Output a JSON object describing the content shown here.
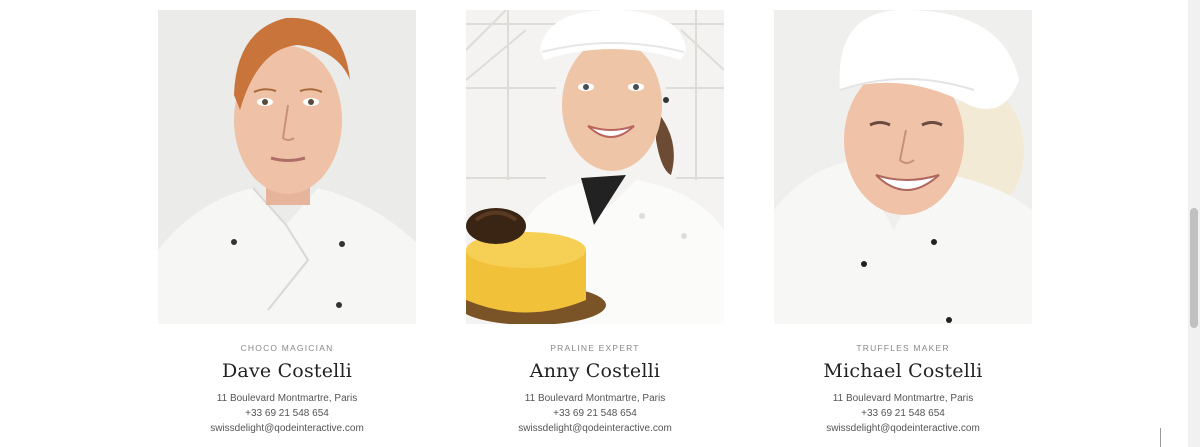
{
  "team": [
    {
      "role": "CHOCO MAGICIAN",
      "name": "Dave Costelli",
      "address": "11 Boulevard Montmartre, Paris",
      "phone": "+33 69 21 548 654",
      "email": "swissdelight@qodeinteractive.com"
    },
    {
      "role": "PRALINE EXPERT",
      "name": "Anny Costelli",
      "address": "11 Boulevard Montmartre, Paris",
      "phone": "+33 69 21 548 654",
      "email": "swissdelight@qodeinteractive.com"
    },
    {
      "role": "TRUFFLES MAKER",
      "name": "Michael Costelli",
      "address": "11 Boulevard Montmartre, Paris",
      "phone": "+33 69 21 548 654",
      "email": "swissdelight@qodeinteractive.com"
    }
  ],
  "colors": {
    "background": "#ffffff",
    "name_text": "#222222",
    "role_text": "#888888",
    "body_text": "#555555",
    "cake_yellow": "#f2c13a"
  },
  "scrollbar": {
    "position_fraction": 0.53
  }
}
